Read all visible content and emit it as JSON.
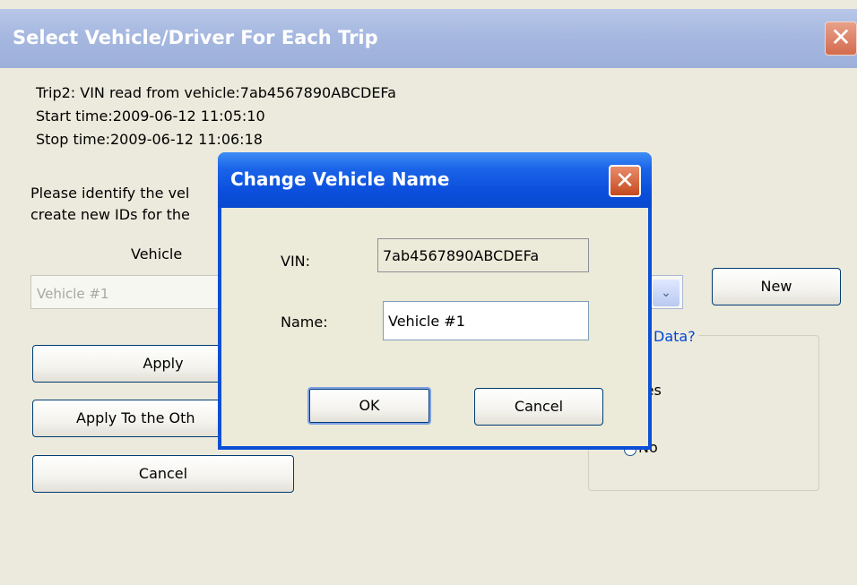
{
  "outer_window": {
    "title": "Select Vehicle/Driver For Each Trip",
    "close_glyph": "✕",
    "trip_line": "Trip2: VIN read from vehicle:7ab4567890ABCDEFa",
    "start_line": "Start time:2009-06-12 11:05:10",
    "stop_line": "Stop time:2009-06-12 11:06:18",
    "prompt_line1": "Please identify the vel",
    "prompt_line2": "create new IDs for the",
    "vehicle_label": "Vehicle",
    "vehicle_combo_value": "Vehicle #1",
    "combo_arrow": "⌄",
    "new_button": "New",
    "apply_button": "Apply",
    "apply_others_button": "Apply To the Oth",
    "cancel_button": "Cancel",
    "group_legend": "Data?",
    "radio_yes": "Yes",
    "radio_no": "No"
  },
  "dialog": {
    "title": "Change Vehicle Name",
    "close_glyph": "✕",
    "vin_label": "VIN:",
    "vin_value": "7ab4567890ABCDEFa",
    "name_label": "Name:",
    "name_value": "Vehicle #1",
    "ok_button": "OK",
    "cancel_button": "Cancel"
  },
  "colors": {
    "dialog_title_bar": "#0a4fd6",
    "group_legend_text": "#0046d5",
    "outer_title_bar": "#a6b8e0"
  }
}
